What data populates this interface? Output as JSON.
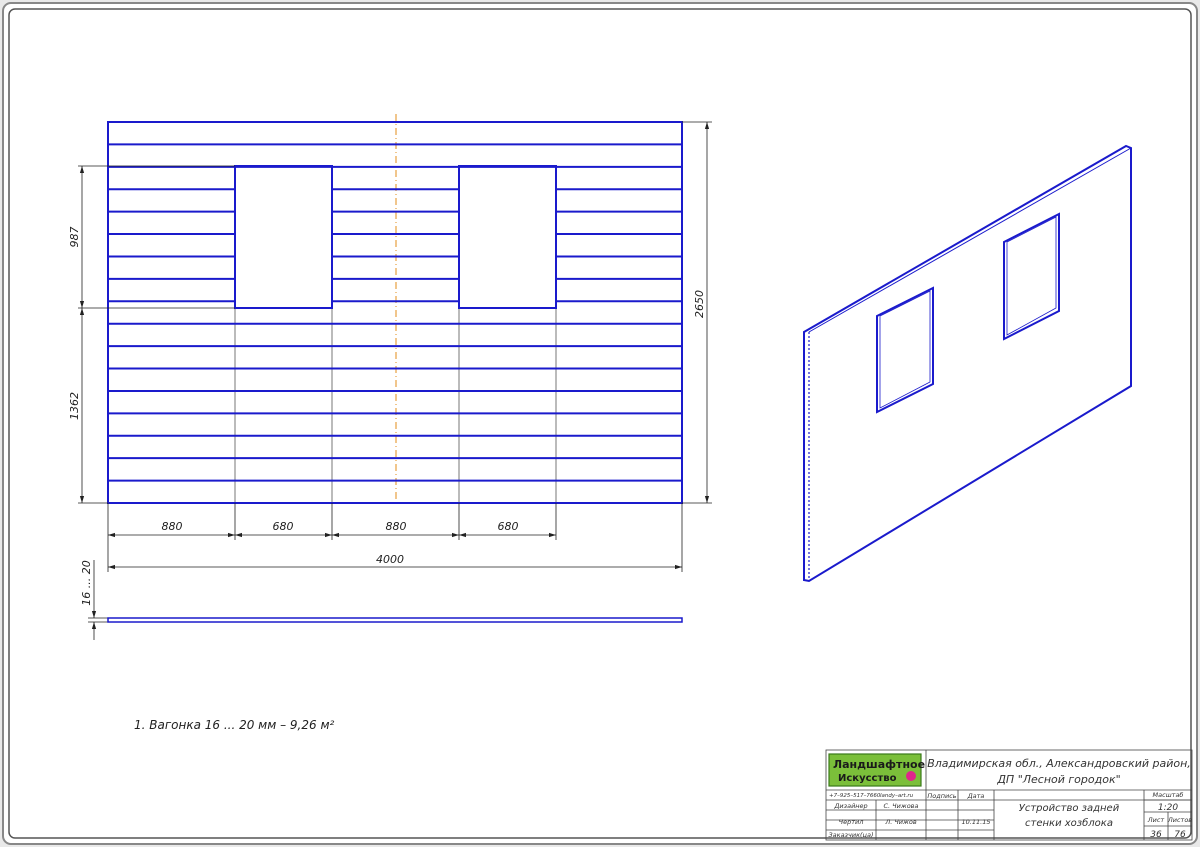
{
  "drawing": {
    "dimensions": {
      "total_height": "2650",
      "upper_height": "987",
      "lower_height": "1362",
      "segments": [
        "880",
        "680",
        "880",
        "680"
      ],
      "total_width": "4000",
      "thickness": "16 ... 20"
    },
    "note": "1. Вагонка 16 ... 20 мм – 9,26 м²",
    "colors": {
      "board": "#1a1acc",
      "aux": "#555555",
      "axis": "#e08000"
    }
  },
  "title_block": {
    "logo_line1": "Ландшафтное",
    "logo_line2": "Искусство",
    "phone": "+7–925–517–7660",
    "site": "landy–art.ru",
    "location_line1": "Владимирская обл., Александровский район,",
    "location_line2": "ДП \"Лесной городок\"",
    "col_signature": "Подпись",
    "col_date": "Дата",
    "designer_role": "Дизайнер",
    "designer_name": "С. Чижова",
    "drafter_role": "Чертил",
    "drafter_name": "Л. Чижов",
    "date": "10.11.15",
    "customer_role": "Заказчик(ца)",
    "sheet_title_line1": "Устройство задней",
    "sheet_title_line2": "стенки хозблока",
    "scale_label": "Масштаб",
    "scale": "1:20",
    "sheet_label": "Лист",
    "sheets_label": "Листов",
    "sheet_no": "36",
    "sheets_total": "76"
  }
}
